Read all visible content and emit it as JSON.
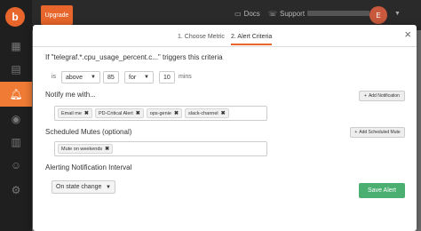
{
  "background": {
    "logo_letter": "b",
    "top_button": "Upgrade",
    "docs_link": "Docs",
    "support_link": "Support",
    "avatar_initial": "E"
  },
  "modal": {
    "close_label": "×",
    "tabs": [
      {
        "label": "1. Choose Metric",
        "active": false
      },
      {
        "label": "2. Alert Criteria",
        "active": true
      }
    ],
    "title": "If \"telegraf.*.cpu_usage_percent.c...\" triggers this criteria",
    "criteria": {
      "is_label": "is",
      "condition": "above",
      "threshold": "85",
      "for_label": "for",
      "duration": "10",
      "unit_label": "mins"
    },
    "notify": {
      "label": "Notify me with...",
      "add_button": "Add Notification",
      "tags": [
        "Email me",
        "PD-Critical Alert",
        "ops-genie",
        "slack-channel"
      ]
    },
    "mutes": {
      "label": "Scheduled Mutes (optional)",
      "add_button": "Add Scheduled Mute",
      "tags": [
        "Mute on weekends"
      ]
    },
    "interval": {
      "label": "Alerting Notification Interval",
      "value": "On state change"
    },
    "save_button": "Save Alert",
    "accent_color": "#e8662b",
    "save_color": "#4caf72"
  }
}
